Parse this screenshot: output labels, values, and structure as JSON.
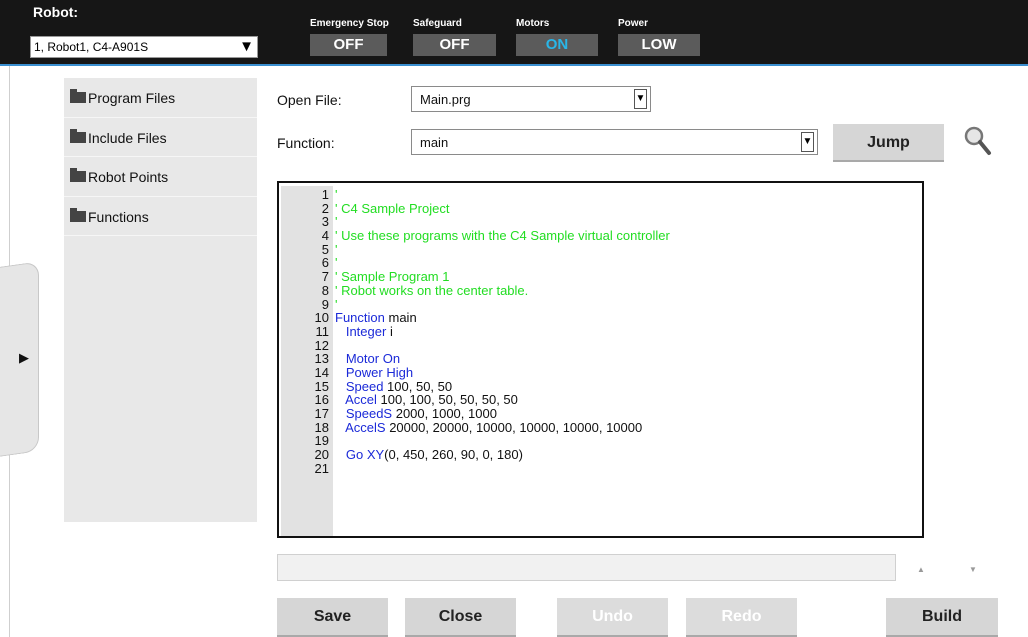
{
  "header": {
    "robot_label": "Robot:",
    "robot_selected": "1, Robot1, C4-A901S",
    "status": [
      {
        "label": "Emergency Stop",
        "value": "OFF"
      },
      {
        "label": "Safeguard",
        "value": "OFF"
      },
      {
        "label": "Motors",
        "value": "ON"
      },
      {
        "label": "Power",
        "value": "LOW"
      }
    ]
  },
  "sidebar": {
    "items": [
      {
        "label": "Program Files"
      },
      {
        "label": "Include Files"
      },
      {
        "label": "Robot Points"
      },
      {
        "label": "Functions"
      }
    ]
  },
  "form": {
    "open_file_label": "Open File:",
    "open_file_value": "Main.prg",
    "function_label": "Function:",
    "function_value": "main",
    "jump_label": "Jump"
  },
  "editor": {
    "lines": [
      {
        "num": "1",
        "code": "'"
      },
      {
        "num": "2",
        "code": "' C4 Sample Project"
      },
      {
        "num": "3",
        "code": "'"
      },
      {
        "num": "4",
        "code": "' Use these programs with the C4 Sample virtual controller"
      },
      {
        "num": "5",
        "code": "'"
      },
      {
        "num": "6",
        "code": "'"
      },
      {
        "num": "7",
        "code": "' Sample Program 1"
      },
      {
        "num": "8",
        "code": "' Robot works on the center table."
      },
      {
        "num": "9",
        "code": "'"
      },
      {
        "num": "10",
        "code": "Function main"
      },
      {
        "num": "11",
        "code": "   Integer i"
      },
      {
        "num": "12",
        "code": ""
      },
      {
        "num": "13",
        "code": "   Motor On"
      },
      {
        "num": "14",
        "code": "   Power High"
      },
      {
        "num": "15",
        "code": "   Speed 100, 50, 50"
      },
      {
        "num": "16",
        "code": "   Accel 100, 100, 50, 50, 50, 50"
      },
      {
        "num": "17",
        "code": "   SpeedS 2000, 1000, 1000"
      },
      {
        "num": "18",
        "code": "   AccelS 20000, 20000, 10000, 10000, 10000, 10000"
      },
      {
        "num": "19",
        "code": ""
      },
      {
        "num": "20",
        "code": "   Go XY(0, 450, 260, 90, 0, 180)"
      },
      {
        "num": "21",
        "code": ""
      }
    ]
  },
  "footer": {
    "save_label": "Save",
    "close_label": "Close",
    "undo_label": "Undo",
    "redo_label": "Redo",
    "build_label": "Build",
    "scroll_up_glyph": "▲",
    "scroll_down_glyph": "▼"
  },
  "colors": {
    "comment": "#22dd22",
    "keyword": "#1b2ad8",
    "motors_on": "#29b6e8",
    "accent": "#3a8fd0"
  },
  "icons": [
    "folder-icon",
    "search-icon",
    "chevron-down-icon",
    "drawer-expand-icon"
  ]
}
